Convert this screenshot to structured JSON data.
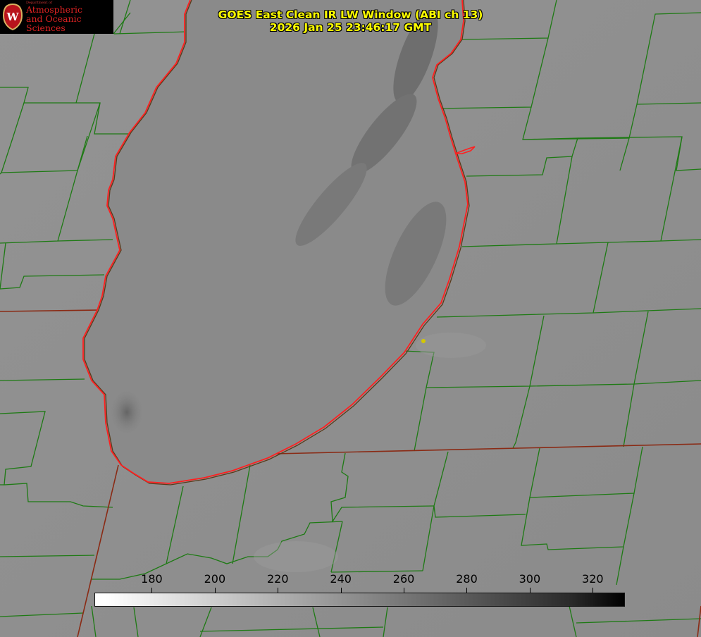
{
  "title": {
    "line1": "GOES East Clean IR LW Window (ABI ch 13)",
    "line2": "2026 Jan 25 23:46:17 GMT"
  },
  "logo": {
    "department": "Department of",
    "line1": "Atmospheric",
    "line2": "and Oceanic Sciences",
    "seal_letter": "W"
  },
  "colorbar": {
    "min": 162,
    "max": 330,
    "ticks": [
      "180",
      "200",
      "220",
      "240",
      "260",
      "280",
      "300",
      "320"
    ],
    "tick_values": [
      180,
      200,
      220,
      240,
      260,
      280,
      300,
      320
    ],
    "colormap": "grayscale, white = cold, black = warm"
  },
  "map_colors": {
    "county_lines": "#1e7a14",
    "state_lines": "#8a2a14",
    "lake_shore": "#ff2020",
    "background": "#8e8e8e",
    "lake": "#8a8a8a",
    "plume": "#6a6a6a",
    "marker": "#d4c800"
  }
}
